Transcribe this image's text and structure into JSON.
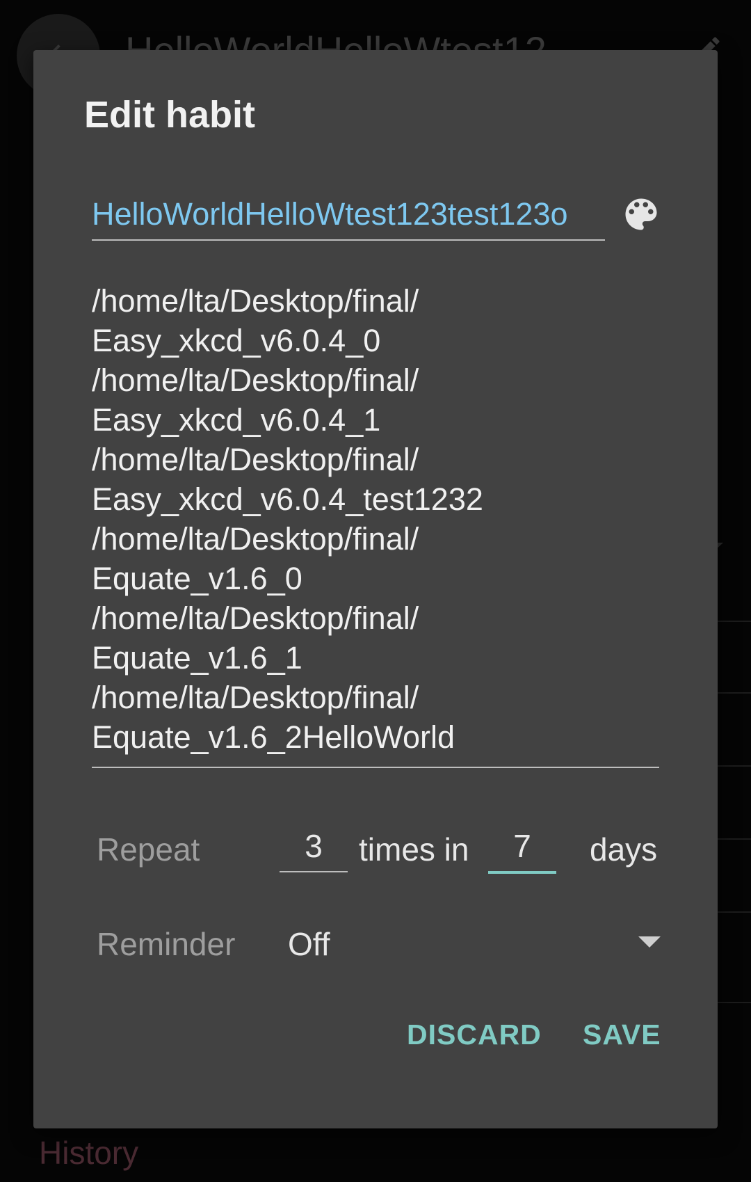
{
  "background": {
    "title": "HelloWorldHelloWtest12",
    "history_label": "History"
  },
  "dialog": {
    "title": "Edit habit",
    "name_value": "HelloWorldHelloWtest123test123o",
    "description_lines": [
      "/home/lta/Desktop/final/",
      "Easy_xkcd_v6.0.4_0",
      "/home/lta/Desktop/final/",
      "Easy_xkcd_v6.0.4_1",
      "/home/lta/Desktop/final/",
      "Easy_xkcd_v6.0.4_test1232",
      "/home/lta/Desktop/final/",
      "Equate_v1.6_0",
      "/home/lta/Desktop/final/",
      "Equate_v1.6_1",
      "/home/lta/Desktop/final/",
      "Equate_v1.6_2HelloWorld"
    ],
    "repeat": {
      "label": "Repeat",
      "times": "3",
      "times_in_label": "times in",
      "days": "7",
      "days_label": "days"
    },
    "reminder": {
      "label": "Reminder",
      "value": "Off"
    },
    "buttons": {
      "discard": "DISCARD",
      "save": "SAVE"
    }
  },
  "colors": {
    "dialog_bg": "#424242",
    "accent": "#80cbc4",
    "name_text": "#7ec8f0"
  },
  "icons": {
    "back": "arrow-back-icon",
    "edit": "pencil-icon",
    "palette": "palette-icon",
    "dropdown": "chevron-down-icon"
  }
}
